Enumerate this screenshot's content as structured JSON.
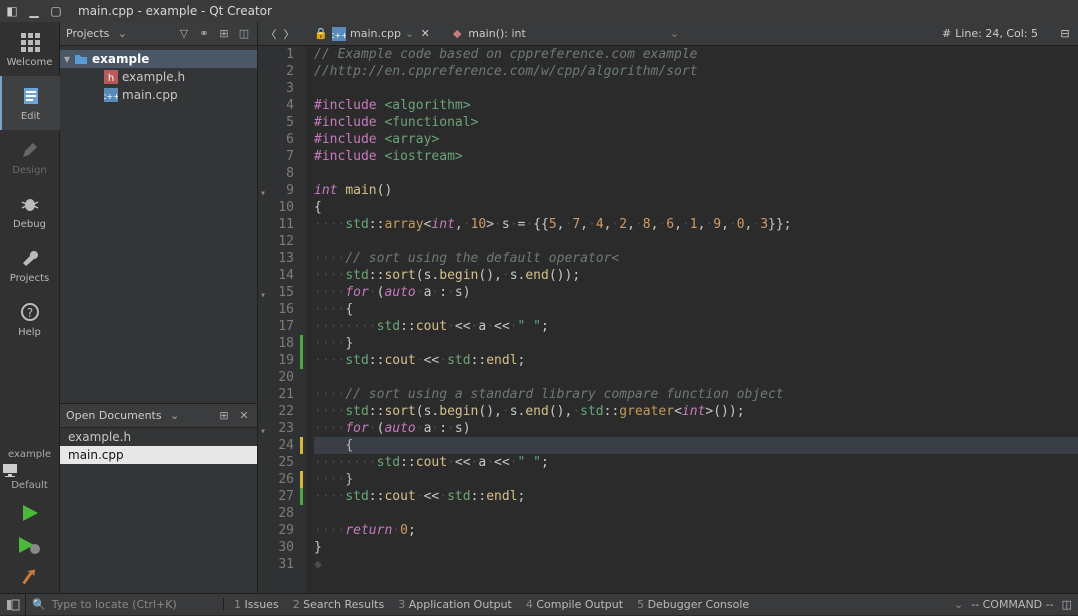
{
  "window": {
    "title": "main.cpp - example - Qt Creator"
  },
  "leftbar": {
    "items": [
      {
        "label": "Welcome"
      },
      {
        "label": "Edit"
      },
      {
        "label": "Design"
      },
      {
        "label": "Debug"
      },
      {
        "label": "Projects"
      },
      {
        "label": "Help"
      }
    ],
    "project": "example",
    "kit": "Default"
  },
  "projects": {
    "header": "Projects",
    "root": {
      "label": "example"
    },
    "files": [
      {
        "label": "example.h"
      },
      {
        "label": "main.cpp"
      }
    ]
  },
  "opendocs": {
    "header": "Open Documents",
    "items": [
      {
        "label": "example.h"
      },
      {
        "label": "main.cpp"
      }
    ]
  },
  "editor": {
    "tab_file": "main.cpp",
    "symbol": "main(): int",
    "lineinfo_prefix": "#",
    "lineinfo": "Line: 24, Col: 5"
  },
  "code": {
    "lines": [
      {
        "n": 1,
        "html": "<span class='tok-cmt'>// Example code based on cppreference.com example</span>"
      },
      {
        "n": 2,
        "html": "<span class='tok-cmt'>//http://en.cppreference.com/w/cpp/algorithm/sort</span>"
      },
      {
        "n": 3,
        "html": ""
      },
      {
        "n": 4,
        "html": "<span class='tok-pp'>#include</span> <span class='tok-inc'>&lt;algorithm&gt;</span>"
      },
      {
        "n": 5,
        "html": "<span class='tok-pp'>#include</span> <span class='tok-inc'>&lt;functional&gt;</span>"
      },
      {
        "n": 6,
        "html": "<span class='tok-pp'>#include</span> <span class='tok-inc'>&lt;array&gt;</span>"
      },
      {
        "n": 7,
        "html": "<span class='tok-pp'>#include</span> <span class='tok-inc'>&lt;iostream&gt;</span>"
      },
      {
        "n": 8,
        "html": ""
      },
      {
        "n": 9,
        "fold": true,
        "html": "<span class='tok-kw'>int</span> <span class='tok-fn'>main</span>()"
      },
      {
        "n": 10,
        "html": "{"
      },
      {
        "n": 11,
        "html": "<span class='tok-dot'>····</span><span class='tok-ns'>std</span>::<span class='tok-type'>array</span>&lt;<span class='tok-kw'>int</span>,<span class='tok-dot'>·</span><span class='tok-num'>10</span>&gt;<span class='tok-dot'>·</span>s<span class='tok-dot'>·</span>=<span class='tok-dot'>·</span>{{<span class='tok-num'>5</span>,<span class='tok-dot'>·</span><span class='tok-num'>7</span>,<span class='tok-dot'>·</span><span class='tok-num'>4</span>,<span class='tok-dot'>·</span><span class='tok-num'>2</span>,<span class='tok-dot'>·</span><span class='tok-num'>8</span>,<span class='tok-dot'>·</span><span class='tok-num'>6</span>,<span class='tok-dot'>·</span><span class='tok-num'>1</span>,<span class='tok-dot'>·</span><span class='tok-num'>9</span>,<span class='tok-dot'>·</span><span class='tok-num'>0</span>,<span class='tok-dot'>·</span><span class='tok-num'>3</span>}};"
      },
      {
        "n": 12,
        "html": ""
      },
      {
        "n": 13,
        "html": "<span class='tok-dot'>····</span><span class='tok-cmt'>// sort using the default operator&lt;</span>"
      },
      {
        "n": 14,
        "html": "<span class='tok-dot'>····</span><span class='tok-ns'>std</span>::<span class='tok-fn'>sort</span>(s.<span class='tok-fn'>begin</span>(),<span class='tok-dot'>·</span>s.<span class='tok-fn'>end</span>());"
      },
      {
        "n": 15,
        "fold": true,
        "html": "<span class='tok-dot'>····</span><span class='tok-kw'>for</span><span class='tok-dot'>·</span>(<span class='tok-kw'>auto</span><span class='tok-dot'>·</span>a<span class='tok-dot'>·</span>:<span class='tok-dot'>·</span>s)"
      },
      {
        "n": 16,
        "html": "<span class='tok-dot'>····</span>{"
      },
      {
        "n": 17,
        "html": "<span class='tok-dot'>········</span><span class='tok-ns'>std</span>::<span class='tok-name'>cout</span><span class='tok-dot'>·</span>&lt;&lt;<span class='tok-dot'>·</span>a<span class='tok-dot'>·</span>&lt;&lt;<span class='tok-dot'>·</span><span class='tok-str'>\" \"</span>;"
      },
      {
        "n": 18,
        "mark": "g",
        "html": "<span class='tok-dot'>····</span>}"
      },
      {
        "n": 19,
        "mark": "g",
        "html": "<span class='tok-dot'>····</span><span class='tok-ns'>std</span>::<span class='tok-name'>cout</span><span class='tok-dot'>·</span>&lt;&lt;<span class='tok-dot'>·</span><span class='tok-ns'>std</span>::<span class='tok-name'>endl</span>;"
      },
      {
        "n": 20,
        "html": ""
      },
      {
        "n": 21,
        "html": "<span class='tok-dot'>····</span><span class='tok-cmt'>// sort using a standard library compare function object</span>"
      },
      {
        "n": 22,
        "html": "<span class='tok-dot'>····</span><span class='tok-ns'>std</span>::<span class='tok-fn'>sort</span>(s.<span class='tok-fn'>begin</span>(),<span class='tok-dot'>·</span>s.<span class='tok-fn'>end</span>(),<span class='tok-dot'>·</span><span class='tok-ns'>std</span>::<span class='tok-type'>greater</span>&lt;<span class='tok-kw'>int</span>&gt;());"
      },
      {
        "n": 23,
        "fold": true,
        "html": "<span class='tok-dot'>····</span><span class='tok-kw'>for</span><span class='tok-dot'>·</span>(<span class='tok-kw'>auto</span><span class='tok-dot'>·</span>a<span class='tok-dot'>·</span>:<span class='tok-dot'>·</span>s)"
      },
      {
        "n": 24,
        "mark": "y",
        "curr": true,
        "html": "<span class='tok-dot'>····</span><span class='tok-op'>{</span>"
      },
      {
        "n": 25,
        "html": "<span class='tok-dot'>········</span><span class='tok-ns'>std</span>::<span class='tok-name'>cout</span><span class='tok-dot'>·</span>&lt;&lt;<span class='tok-dot'>·</span>a<span class='tok-dot'>·</span>&lt;&lt;<span class='tok-dot'>·</span><span class='tok-str'>\" \"</span>;"
      },
      {
        "n": 26,
        "mark": "y",
        "html": "<span class='tok-dot'>····</span><span class='tok-op'>}</span>"
      },
      {
        "n": 27,
        "mark": "g",
        "html": "<span class='tok-dot'>····</span><span class='tok-ns'>std</span>::<span class='tok-name'>cout</span><span class='tok-dot'>·</span>&lt;&lt;<span class='tok-dot'>·</span><span class='tok-ns'>std</span>::<span class='tok-name'>endl</span>;"
      },
      {
        "n": 28,
        "html": ""
      },
      {
        "n": 29,
        "html": "<span class='tok-dot'>····</span><span class='tok-kw'>return</span><span class='tok-dot'>·</span><span class='tok-num'>0</span>;"
      },
      {
        "n": 30,
        "html": "}"
      },
      {
        "n": 31,
        "html": "<span class='tok-dot'>◆</span>"
      }
    ]
  },
  "statusbar": {
    "locate_placeholder": "Type to locate (Ctrl+K)",
    "tabs": [
      {
        "n": "1",
        "label": "Issues"
      },
      {
        "n": "2",
        "label": "Search Results"
      },
      {
        "n": "3",
        "label": "Application Output"
      },
      {
        "n": "4",
        "label": "Compile Output"
      },
      {
        "n": "5",
        "label": "Debugger Console"
      }
    ],
    "mode": "-- COMMAND --"
  }
}
